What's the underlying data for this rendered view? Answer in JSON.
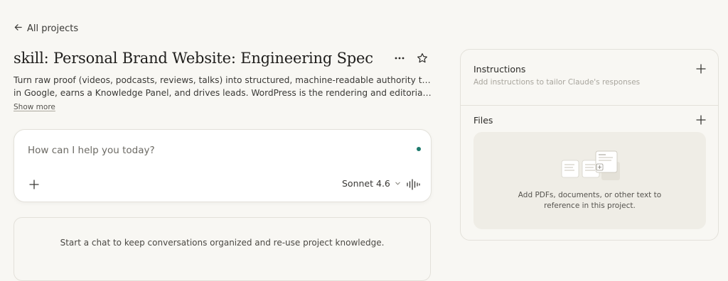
{
  "nav": {
    "back_label": "All projects"
  },
  "project": {
    "title": "skill: Personal Brand Website: Engineering Spec",
    "description_line1": "Turn raw proof (videos, podcasts, reviews, talks) into structured, machine-readable authority that ranks",
    "description_line2": "in Google, earns a Knowledge Panel, and drives leads. WordPress is the rendering and editorial layer; th…",
    "show_more_label": "Show more"
  },
  "composer": {
    "placeholder": "How can I help you today?",
    "model_label": "Sonnet 4.6",
    "status_dot_color": "#1d7a6d"
  },
  "empty_state": {
    "text": "Start a chat to keep conversations organized and re-use project knowledge."
  },
  "sidebar": {
    "instructions": {
      "title": "Instructions",
      "subtitle": "Add instructions to tailor Claude's responses"
    },
    "files": {
      "title": "Files",
      "empty_line1": "Add PDFs, documents, or other text to",
      "empty_line2": "reference in this project."
    }
  },
  "icons": [
    "arrow-left-icon",
    "more-horizontal-icon",
    "star-icon",
    "plus-icon",
    "chevron-down-icon",
    "voice-waveform-icon",
    "documents-illustration"
  ]
}
